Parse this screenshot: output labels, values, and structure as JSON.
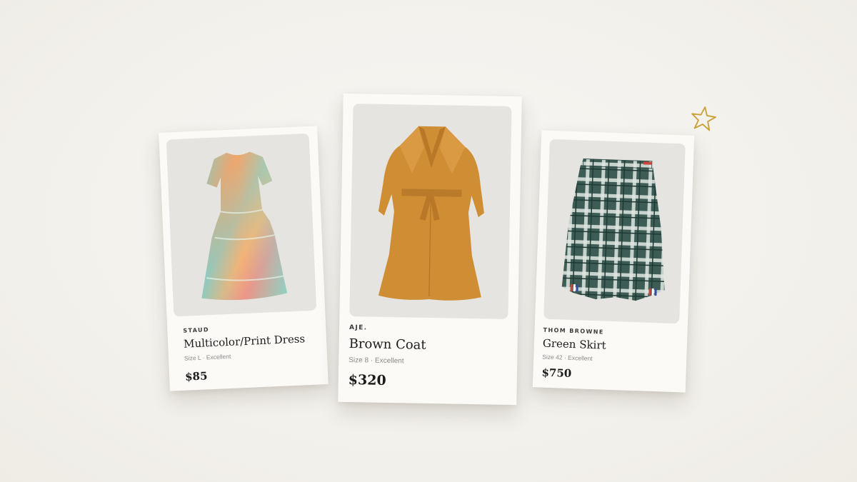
{
  "products": [
    {
      "brand": "STAUD",
      "name": "Multicolor/Print Dress",
      "meta": "Size L · Excellent",
      "price": "$85",
      "image_icon": "dress-photo"
    },
    {
      "brand": "AJE.",
      "name": "Brown Coat",
      "meta": "Size 8 · Excellent",
      "price": "$320",
      "image_icon": "coat-photo"
    },
    {
      "brand": "THOM BROWNE",
      "name": "Green Skirt",
      "meta": "Size 42 · Excellent",
      "price": "$750",
      "image_icon": "skirt-photo"
    }
  ],
  "decoration": {
    "icon": "star-icon",
    "color": "#c9a23a"
  },
  "colors": {
    "background": "#f3f1ec",
    "card": "#fbfaf7",
    "photo_bg": "#e6e4e1",
    "coat": "#d08f35",
    "skirt": "#3f5f58"
  }
}
